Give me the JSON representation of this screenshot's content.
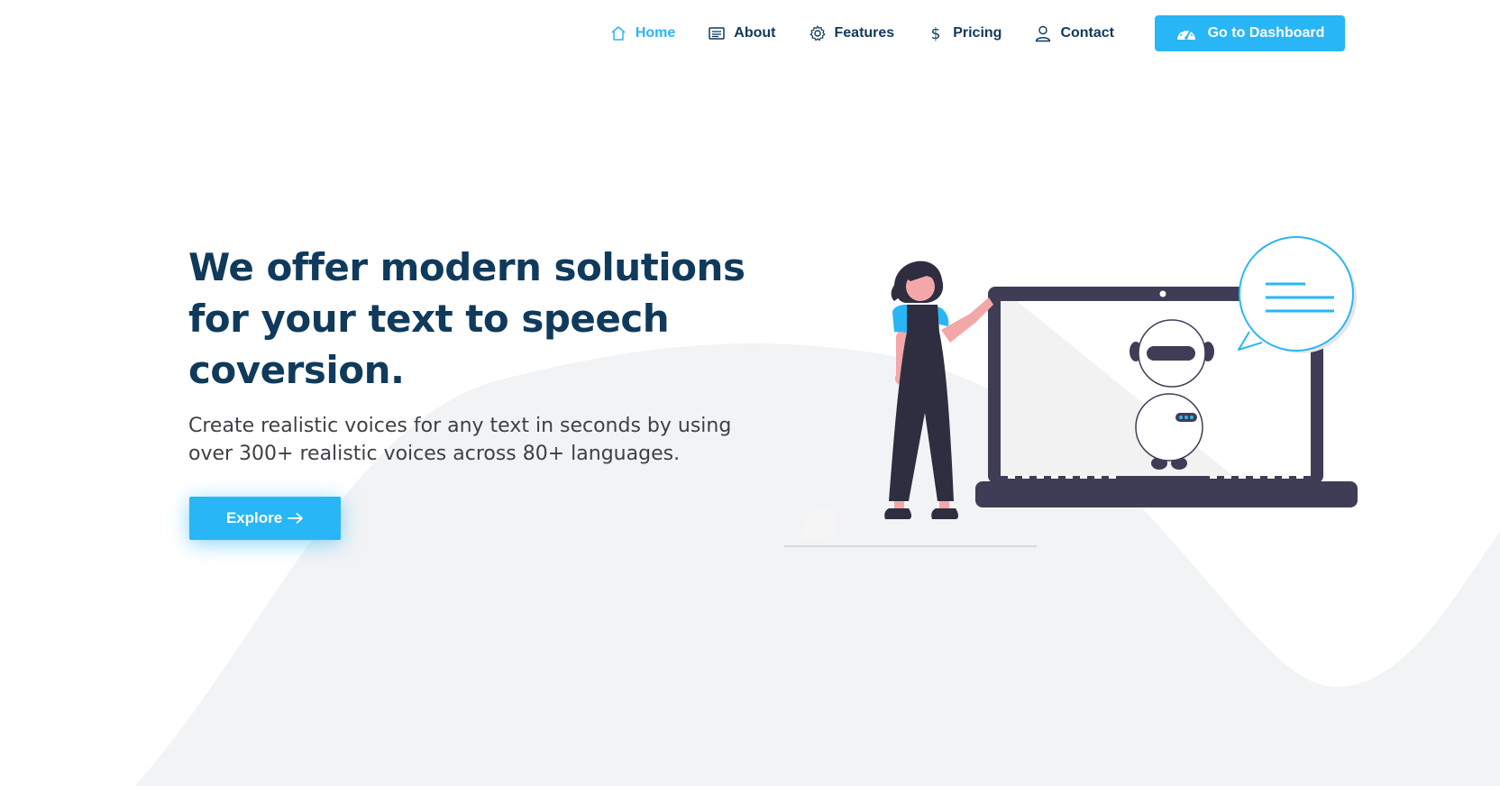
{
  "nav": {
    "items": [
      {
        "label": "Home",
        "icon": "home-icon",
        "active": true
      },
      {
        "label": "About",
        "icon": "document-icon",
        "active": false
      },
      {
        "label": "Features",
        "icon": "gear-icon",
        "active": false
      },
      {
        "label": "Pricing",
        "icon": "dollar-icon",
        "active": false
      },
      {
        "label": "Contact",
        "icon": "user-icon",
        "active": false
      }
    ],
    "dashboard_button": {
      "label": "Go to Dashboard",
      "icon": "speedometer-icon"
    }
  },
  "hero": {
    "title": "We offer modern solutions for your text to speech coversion.",
    "subtitle": "Create realistic voices for any text in seconds by using over 300+ realistic voices across 80+ languages.",
    "cta_label": "Explore",
    "cta_icon": "arrow-right-icon"
  },
  "illustration": {
    "subject": "woman-presenting-robot-on-laptop-illustration"
  },
  "colors": {
    "accent": "#29b6f6",
    "heading": "#0f3a5c",
    "body_text": "#3f4046",
    "wave_bg": "#f2f3f5",
    "dark_ink": "#3f3d56"
  }
}
